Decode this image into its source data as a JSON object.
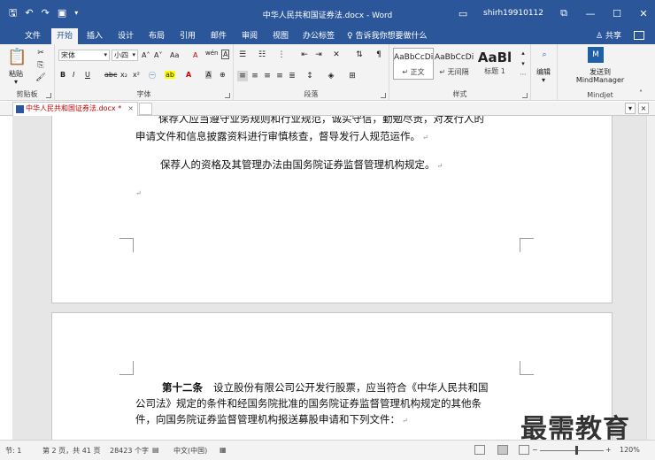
{
  "window": {
    "title": "中华人民共和国证券法.docx - Word",
    "user": "shirh19910112"
  },
  "ribbon_tabs": [
    "文件",
    "开始",
    "插入",
    "设计",
    "布局",
    "引用",
    "邮件",
    "审阅",
    "视图",
    "办公标签"
  ],
  "active_tab": "开始",
  "tell_me": "告诉我你想要做什么",
  "share_label": "共享",
  "clipboard": {
    "paste_label": "粘贴",
    "group_label": "剪贴板"
  },
  "font": {
    "family": "宋体",
    "size": "小四",
    "group_label": "字体",
    "buttons": {
      "bold": "B",
      "italic": "I",
      "underline": "U",
      "strike": "abc",
      "sub": "x₂",
      "sup": "x²",
      "grow": "A˄",
      "shrink": "A˅",
      "case": "Aa",
      "clear": "A",
      "phonetic": "wén",
      "border": "A",
      "color": "A",
      "highlight": "ab",
      "shade": "A",
      "circle": "㊀"
    }
  },
  "paragraph": {
    "group_label": "段落"
  },
  "styles": {
    "group_label": "样式",
    "items": [
      {
        "sample": "AaBbCcDi",
        "name": "↵ 正文"
      },
      {
        "sample": "AaBbCcDi",
        "name": "↵ 无间隔"
      },
      {
        "sample": "AaBl",
        "name": "标题 1"
      }
    ]
  },
  "editing": {
    "label": "编辑"
  },
  "mindjet": {
    "label_line1": "发送到",
    "label_line2": "MindManager",
    "group_label": "Mindjet"
  },
  "doc_tab": {
    "name": "中华人民共和国证券法.docx *",
    "close": "×"
  },
  "document": {
    "page1_lines": [
      "保荐人应当遵守业务规则和行业规范，诚实守信，勤勉尽责，对发行人的",
      "申请文件和信息披露资料进行审慎核查，督导发行人规范运作。",
      "保荐人的资格及其管理办法由国务院证券监督管理机构规定。"
    ],
    "page2_heading": "第十二条",
    "page2_lines": [
      "设立股份有限公司公开发行股票，应当符合《中华人民共和国",
      "公司法》规定的条件和经国务院批准的国务院证券监督管理机构规定的其他条",
      "件，向国务院证券监督管理机构报送募股申请和下列文件："
    ],
    "para_mark": "↵"
  },
  "watermark": "最需教育",
  "status": {
    "section": "节: 1",
    "page": "第 2 页，共 41 页",
    "words": "28423 个字",
    "lang": "中文(中国)",
    "zoom": "120%"
  }
}
